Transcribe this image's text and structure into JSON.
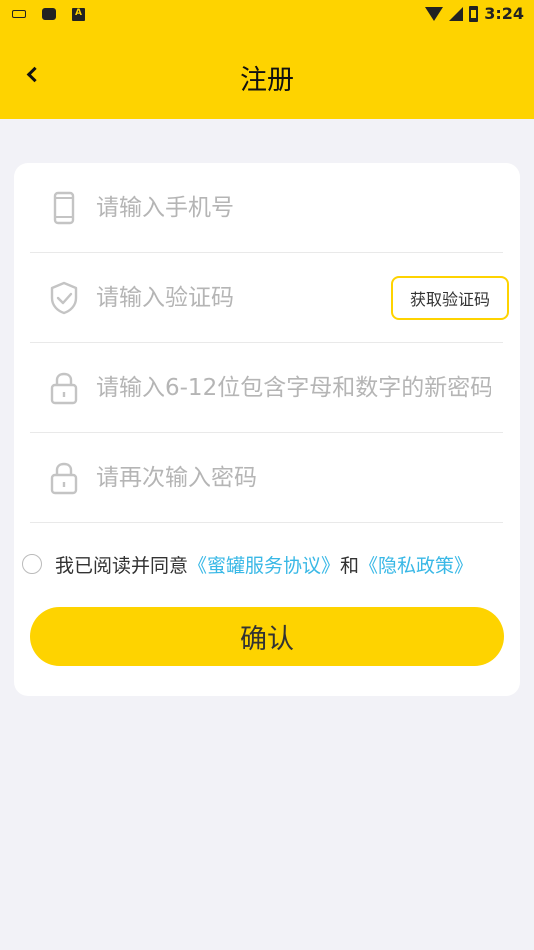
{
  "status_bar": {
    "time": "3:24"
  },
  "header": {
    "title": "注册",
    "back_icon": "chevron-left-icon"
  },
  "form": {
    "phone": {
      "placeholder": "请输入手机号",
      "icon": "phone-icon"
    },
    "code": {
      "placeholder": "请输入验证码",
      "icon": "shield-check-icon",
      "button_label": "获取验证码"
    },
    "password": {
      "placeholder": "请输入6-12位包含字母和数字的新密码",
      "icon": "lock-icon"
    },
    "confirm_password": {
      "placeholder": "请再次输入密码",
      "icon": "lock-icon"
    },
    "agreement": {
      "prefix": "我已阅读并同意",
      "service_link": "《蜜罐服务协议》",
      "conjunction": "和",
      "privacy_link": "《隐私政策》",
      "checked": false
    },
    "submit_label": "确认"
  },
  "colors": {
    "accent": "#fed300",
    "link": "#39b8e6",
    "background": "#f2f2f7"
  }
}
